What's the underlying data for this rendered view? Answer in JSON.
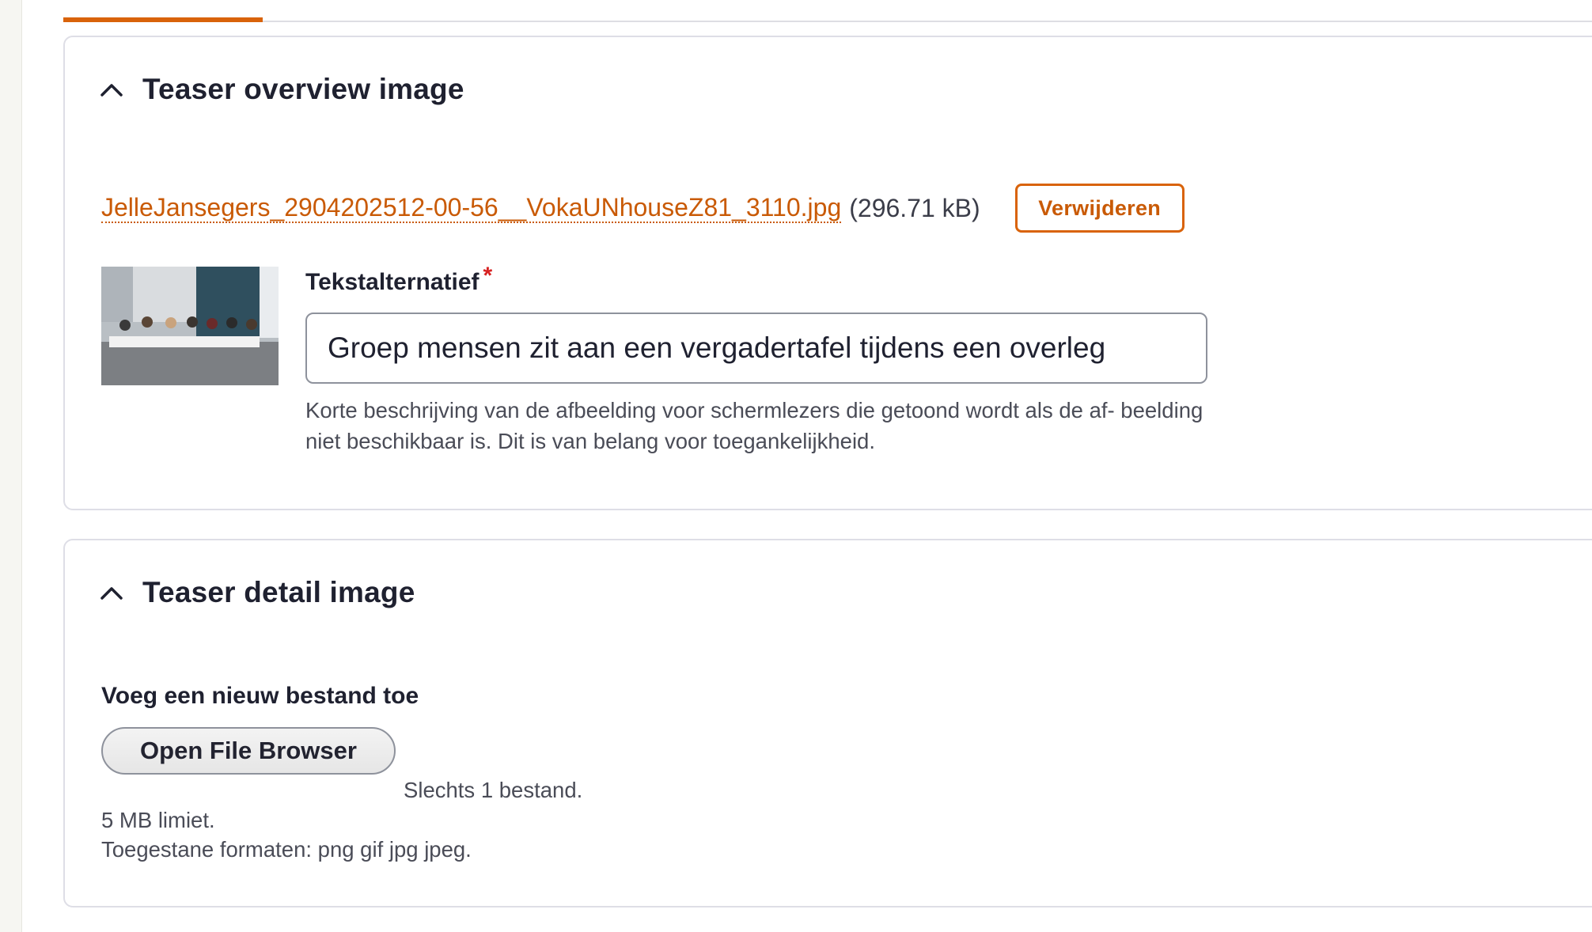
{
  "panels": {
    "overview": {
      "title": "Teaser overview image",
      "file_name": "JelleJansegers_2904202512-00-56__VokaUNhouseZ81_3110.jpg",
      "file_size": "(296.71 kB)",
      "remove_label": "Verwijderen",
      "alt_label": "Tekstalternatief",
      "required_mark": "*",
      "alt_value": "Groep mensen zit aan een vergadertafel tijdens een overleg",
      "alt_description": "Korte beschrijving van de afbeelding voor schermlezers die getoond wordt als de af- beelding niet beschikbaar is. Dit is van belang voor toegankelijkheid."
    },
    "detail": {
      "title": "Teaser detail image",
      "new_file_label": "Voeg een nieuw bestand toe",
      "browse_label": "Open File Browser",
      "hint_count": "Slechts 1 bestand.",
      "hint_size": "5 MB limiet.",
      "hint_formats": "Toegestane formaten: png gif jpg jpeg."
    }
  },
  "icons": {
    "collapse": "chevron-up-icon"
  },
  "colors": {
    "accent": "#d9630a",
    "required": "#d72222"
  }
}
